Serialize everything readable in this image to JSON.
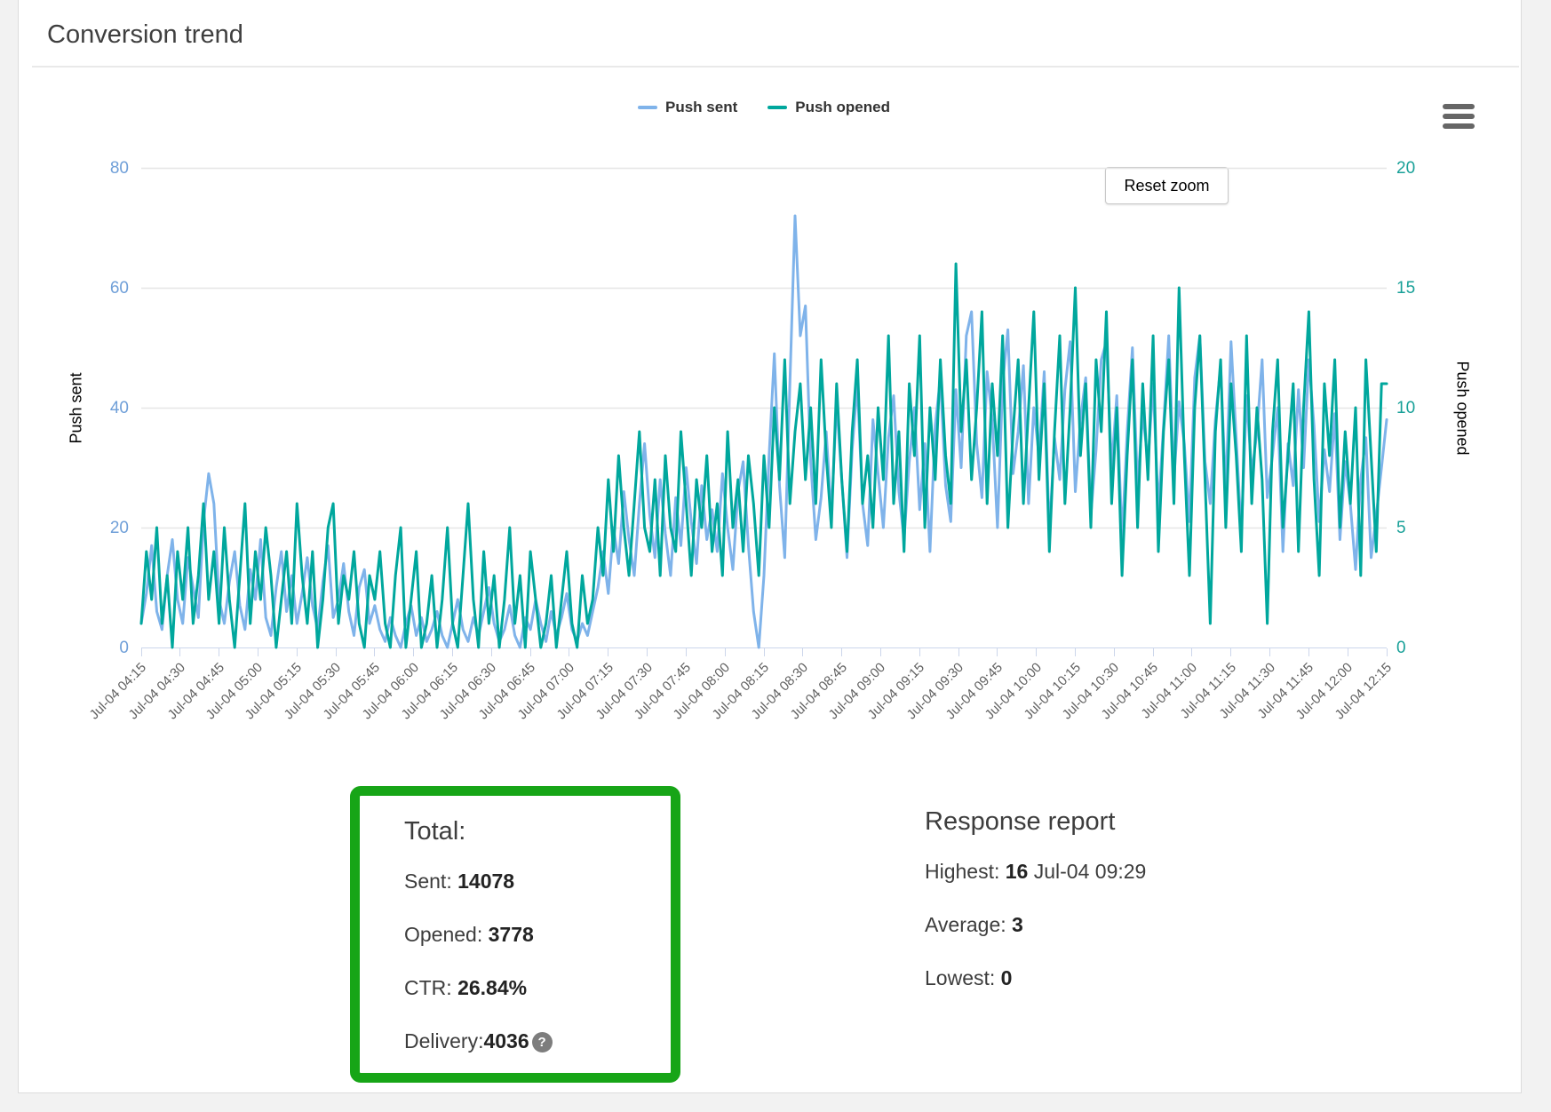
{
  "header": {
    "title": "Conversion trend"
  },
  "chart": {
    "legend": [
      {
        "label": "Push sent",
        "color": "#7fb3ea"
      },
      {
        "label": "Push opened",
        "color": "#00a79d"
      }
    ],
    "reset_zoom_label": "Reset zoom",
    "menu_icon": "hamburger-icon",
    "y_left": {
      "title": "Push sent",
      "ticks": [
        80,
        60,
        40,
        20,
        0
      ],
      "color": "#6f9fd8"
    },
    "y_right": {
      "title": "Push opened",
      "ticks": [
        20,
        15,
        10,
        5,
        0
      ],
      "color": "#18a098"
    },
    "x_tick_labels": [
      "Jul-04 04:15",
      "Jul-04 04:30",
      "Jul-04 04:45",
      "Jul-04 05:00",
      "Jul-04 05:15",
      "Jul-04 05:30",
      "Jul-04 05:45",
      "Jul-04 06:00",
      "Jul-04 06:15",
      "Jul-04 06:30",
      "Jul-04 06:45",
      "Jul-04 07:00",
      "Jul-04 07:15",
      "Jul-04 07:30",
      "Jul-04 07:45",
      "Jul-04 08:00",
      "Jul-04 08:15",
      "Jul-04 08:30",
      "Jul-04 08:45",
      "Jul-04 09:00",
      "Jul-04 09:15",
      "Jul-04 09:30",
      "Jul-04 09:45",
      "Jul-04 10:00",
      "Jul-04 10:15",
      "Jul-04 10:30",
      "Jul-04 10:45",
      "Jul-04 11:00",
      "Jul-04 11:15",
      "Jul-04 11:30",
      "Jul-04 11:45",
      "Jul-04 12:00",
      "Jul-04 12:15"
    ],
    "gridline_color": "#e6e6e6",
    "axis_line_color": "#ccd6eb"
  },
  "chart_data": {
    "type": "line",
    "title": "Conversion trend",
    "x_start": "Jul-04 04:15",
    "x_end": "Jul-04 12:15",
    "x_step_minutes": 2,
    "grid": true,
    "legend_position": "top",
    "y_left_range": [
      0,
      80
    ],
    "y_right_range": [
      0,
      20
    ],
    "series": [
      {
        "name": "Push sent",
        "axis": "left",
        "color": "#7fb3ea",
        "values": [
          4,
          9,
          17,
          6,
          3,
          12,
          18,
          8,
          4,
          15,
          10,
          5,
          21,
          29,
          24,
          8,
          4,
          11,
          16,
          7,
          3,
          13,
          8,
          18,
          5,
          2,
          10,
          16,
          6,
          12,
          4,
          9,
          15,
          7,
          3,
          11,
          17,
          5,
          8,
          14,
          6,
          2,
          10,
          13,
          4,
          7,
          3,
          1,
          5,
          2,
          0,
          4,
          7,
          2,
          5,
          1,
          3,
          6,
          2,
          0,
          4,
          8,
          3,
          1,
          5,
          2,
          6,
          10,
          4,
          1,
          3,
          7,
          2,
          0,
          5,
          3,
          8,
          4,
          1,
          6,
          2,
          5,
          9,
          3,
          1,
          4,
          2,
          6,
          10,
          16,
          9,
          20,
          14,
          26,
          18,
          12,
          24,
          34,
          22,
          15,
          28,
          19,
          12,
          25,
          17,
          30,
          21,
          14,
          27,
          18,
          23,
          16,
          29,
          20,
          13,
          26,
          31,
          17,
          6,
          0,
          12,
          32,
          49,
          27,
          15,
          44,
          72,
          52,
          57,
          31,
          18,
          25,
          36,
          22,
          41,
          28,
          15,
          33,
          44,
          24,
          17,
          38,
          29,
          20,
          35,
          42,
          26,
          18,
          31,
          40,
          23,
          34,
          16,
          37,
          45,
          27,
          21,
          43,
          30,
          52,
          56,
          34,
          25,
          46,
          38,
          20,
          44,
          53,
          29,
          36,
          47,
          24,
          40,
          32,
          46,
          19,
          35,
          28,
          43,
          51,
          26,
          38,
          45,
          22,
          33,
          48,
          51,
          30,
          42,
          18,
          36,
          50,
          27,
          39,
          31,
          44,
          23,
          37,
          52,
          28,
          41,
          34,
          21,
          45,
          52,
          31,
          24,
          38,
          47,
          26,
          51,
          35,
          19,
          42,
          29,
          36,
          48,
          25,
          32,
          40,
          16,
          34,
          27,
          43,
          30,
          48,
          37,
          21,
          33,
          26,
          39,
          18,
          31,
          24,
          13,
          28,
          35,
          15,
          22,
          30,
          38
        ]
      },
      {
        "name": "Push opened",
        "axis": "right",
        "color": "#00a79d",
        "values": [
          1,
          4,
          2,
          5,
          1,
          3,
          0,
          4,
          2,
          5,
          1,
          3,
          6,
          2,
          4,
          1,
          5,
          2,
          0,
          3,
          6,
          1,
          4,
          2,
          5,
          3,
          0,
          2,
          4,
          1,
          6,
          3,
          1,
          4,
          0,
          2,
          5,
          6,
          1,
          3,
          2,
          4,
          1,
          0,
          3,
          2,
          4,
          1,
          0,
          3,
          5,
          0,
          2,
          4,
          0,
          1,
          3,
          0,
          2,
          5,
          1,
          0,
          3,
          6,
          2,
          0,
          4,
          1,
          3,
          0,
          2,
          5,
          1,
          3,
          0,
          4,
          2,
          0,
          1,
          3,
          0,
          2,
          4,
          1,
          0,
          3,
          1,
          2,
          5,
          3,
          7,
          4,
          8,
          5,
          3,
          6,
          9,
          5,
          4,
          7,
          3,
          8,
          5,
          4,
          9,
          6,
          3,
          7,
          5,
          8,
          4,
          6,
          3,
          9,
          5,
          7,
          4,
          8,
          6,
          3,
          8,
          5,
          10,
          7,
          12,
          6,
          9,
          11,
          7,
          10,
          6,
          12,
          8,
          5,
          11,
          7,
          4,
          9,
          12,
          6,
          8,
          5,
          10,
          7,
          13,
          6,
          9,
          4,
          11,
          8,
          13,
          5,
          10,
          7,
          12,
          8,
          6,
          16,
          9,
          12,
          7,
          10,
          14,
          6,
          11,
          8,
          13,
          5,
          9,
          12,
          6,
          10,
          14,
          7,
          11,
          4,
          9,
          13,
          6,
          10,
          15,
          8,
          11,
          5,
          12,
          9,
          14,
          6,
          10,
          3,
          8,
          12,
          5,
          11,
          7,
          13,
          4,
          9,
          12,
          6,
          15,
          8,
          3,
          10,
          13,
          7,
          1,
          9,
          12,
          5,
          11,
          8,
          4,
          13,
          6,
          10,
          7,
          1,
          9,
          12,
          5,
          8,
          11,
          4,
          10,
          14,
          7,
          3,
          11,
          8,
          12,
          5,
          9,
          6,
          10,
          3,
          12,
          8,
          4,
          11,
          11
        ]
      }
    ]
  },
  "totals": {
    "heading": "Total:",
    "rows": [
      {
        "label": "Sent: ",
        "value": "14078"
      },
      {
        "label": "Opened: ",
        "value": "3778"
      },
      {
        "label": "CTR: ",
        "value": "26.84%"
      },
      {
        "label": "Delivery:",
        "value": "4036",
        "help": "?"
      }
    ],
    "box_color": "#17a517"
  },
  "response_report": {
    "heading": "Response report",
    "rows": [
      {
        "label": "Highest: ",
        "value": "16",
        "suffix": " Jul-04 09:29"
      },
      {
        "label": "Average: ",
        "value": "3",
        "suffix": ""
      },
      {
        "label": "Lowest: ",
        "value": "0",
        "suffix": ""
      }
    ]
  }
}
